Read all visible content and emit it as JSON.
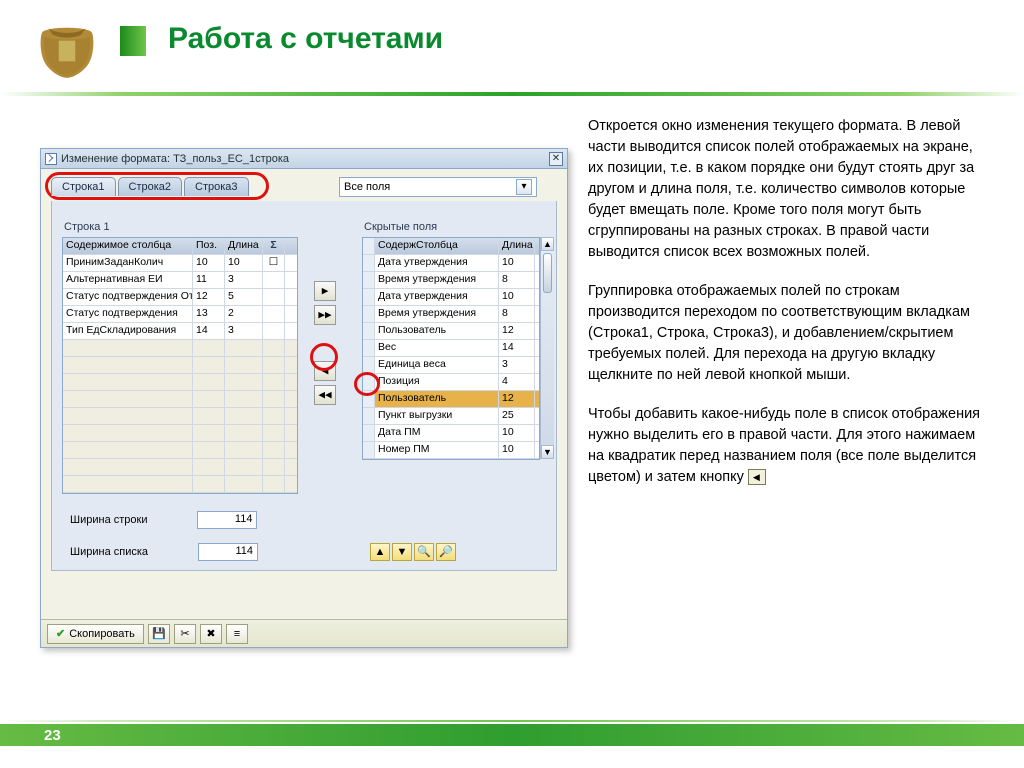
{
  "slide": {
    "title": "Работа с отчетами",
    "page_number": "23"
  },
  "desc": {
    "p1": "Откроется окно изменения текущего формата. В левой части выводится список полей отображаемых на экране, их позиции, т.е. в каком порядке они будут стоять друг за другом и длина поля, т.е. количество символов которые будет вмещать поле. Кроме того поля могут быть сгруппированы на разных строках. В правой части выводится список всех возможных полей.",
    "p2": "Группировка отображаемых полей по строкам производится переходом по соответствующим вкладкам (Строка1, Строка, Строка3), и добавлением/скрытием требуемых полей. Для перехода на другую вкладку щелкните по ней левой кнопкой мыши.",
    "p3a": "Чтобы добавить какое-нибудь поле в список отображения нужно выделить его в правой части. Для этого нажимаем на квадратик перед названием поля (все поле выделится цветом) и затем кнопку "
  },
  "window": {
    "title": "Изменение формата: ТЗ_польз_ЕС_1строка",
    "tabs": [
      "Строка1",
      "Строка2",
      "Строка3"
    ],
    "all_fields_label": "Все поля",
    "left": {
      "group": "Строка 1",
      "headers": {
        "col0": "Содержимое столбца",
        "col1": "Поз.",
        "col2": "Длина",
        "sigma": "Σ"
      },
      "rows": [
        {
          "c0": "ПринимЗаданКолич",
          "c1": "10",
          "c2": "10"
        },
        {
          "c0": "Альтернативная ЕИ",
          "c1": "11",
          "c2": "3"
        },
        {
          "c0": "Статус подтверждения Отг",
          "c1": "12",
          "c2": "5"
        },
        {
          "c0": "Статус подтверждения",
          "c1": "13",
          "c2": "2"
        },
        {
          "c0": "Тип ЕдСкладирования",
          "c1": "14",
          "c2": "3"
        }
      ],
      "line_width_label": "Ширина строки",
      "line_width_value": "114",
      "list_width_label": "Ширина списка",
      "list_width_value": "114"
    },
    "right": {
      "group": "Скрытые поля",
      "headers": {
        "col0": "СодержСтолбца",
        "col1": "Длина"
      },
      "rows": [
        {
          "c0": "Дата утверждения",
          "c1": "10"
        },
        {
          "c0": "Время утверждения",
          "c1": "8"
        },
        {
          "c0": "Дата утверждения",
          "c1": "10"
        },
        {
          "c0": "Время утверждения",
          "c1": "8"
        },
        {
          "c0": "Пользователь",
          "c1": "12"
        },
        {
          "c0": "Вес",
          "c1": "14"
        },
        {
          "c0": "Единица веса",
          "c1": "3"
        },
        {
          "c0": "Позиция",
          "c1": "4"
        },
        {
          "c0": "Пользователь",
          "c1": "12",
          "selected": true
        },
        {
          "c0": "Пункт выгрузки",
          "c1": "25"
        },
        {
          "c0": "Дата ПМ",
          "c1": "10"
        },
        {
          "c0": "Номер ПМ",
          "c1": "10"
        }
      ]
    },
    "footer": {
      "copy": "Скопировать"
    }
  }
}
